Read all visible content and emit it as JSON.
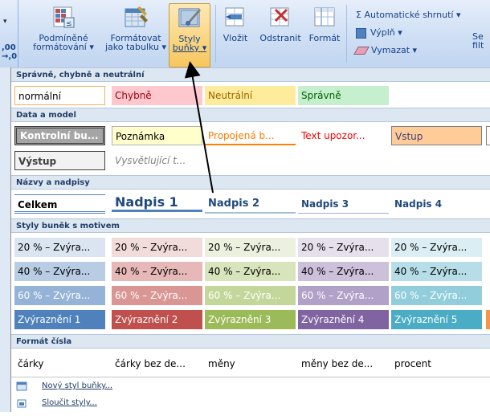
{
  "ribbon": {
    "left_stub": {
      "top": "▾",
      "bottom": "⁺⁰⁰\n⁻⁰"
    },
    "buttons": [
      {
        "label1": "Podmíněné",
        "label2": "formátování ▾"
      },
      {
        "label1": "Formátovat",
        "label2": "jako tabulku ▾"
      },
      {
        "label1": "Styly",
        "label2": "buňky ▾"
      },
      {
        "label1": "Vložit",
        "label2": ""
      },
      {
        "label1": "Odstranit",
        "label2": ""
      },
      {
        "label1": "Formát",
        "label2": ""
      }
    ],
    "editing": {
      "autosum": "Σ  Automatické shrnutí ▾",
      "fill": "Výplň ▾",
      "clear": "Vymazat ▾",
      "right_cut_top": "Se",
      "right_cut_bottom": "filt"
    }
  },
  "gallery": {
    "sections": [
      {
        "title": "Správně, chybně a neutrální"
      },
      {
        "title": "Data a model"
      },
      {
        "title": "Názvy a nadpisy"
      },
      {
        "title": "Styly buněk s motivem"
      },
      {
        "title": "Formát čísla"
      }
    ],
    "good_bad": [
      "normální",
      "Chybně",
      "Neutrální",
      "Správně"
    ],
    "data_model_row1": [
      "Kontrolní bu...",
      "Poznámka",
      "Propojená b...",
      "Text upozor...",
      "Vstup"
    ],
    "data_model_row2": [
      "Výstup",
      "Vysvětlující t..."
    ],
    "titles": [
      "Celkem",
      "Nadpis 1",
      "Nadpis 2",
      "Nadpis 3",
      "Nadpis 4"
    ],
    "themed_20": [
      "20 % – Zvýra...",
      "20 % – Zvýra...",
      "20 % – Zvýra...",
      "20 % – Zvýra...",
      "20 % – Zvýra..."
    ],
    "themed_40": [
      "40 % – Zvýra...",
      "40 % – Zvýra...",
      "40 % – Zvýra...",
      "40 % – Zvýra...",
      "40 % – Zvýra..."
    ],
    "themed_60": [
      "60 % – Zvýra...",
      "60 % – Zvýra...",
      "60 % – Zvýra...",
      "60 % – Zvýra...",
      "60 % – Zvýra..."
    ],
    "accents": [
      "Zvýraznění 1",
      "Zvýraznění 2",
      "Zvýraznění 3",
      "Zvýraznění 4",
      "Zvýraznění 5"
    ],
    "number": [
      "čárky",
      "čárky bez de...",
      "měny",
      "měny bez de...",
      "procent"
    ],
    "footer": [
      "Nový styl buňky...",
      "Sloučit styly..."
    ]
  },
  "colors": {
    "accent_20": [
      "#dbe5f1",
      "#f2dcdb",
      "#ebf1de",
      "#e5e0ec",
      "#dbeef3"
    ],
    "accent_40": [
      "#b8cce4",
      "#e6b8b7",
      "#d7e4bc",
      "#ccc0da",
      "#b7dee8"
    ],
    "accent_60": [
      "#95b3d7",
      "#da9694",
      "#c4d79b",
      "#b1a0c7",
      "#92cddc"
    ],
    "accent_100": [
      "#4f81bd",
      "#c0504d",
      "#9bbb59",
      "#8064a2",
      "#4bacc6"
    ]
  }
}
